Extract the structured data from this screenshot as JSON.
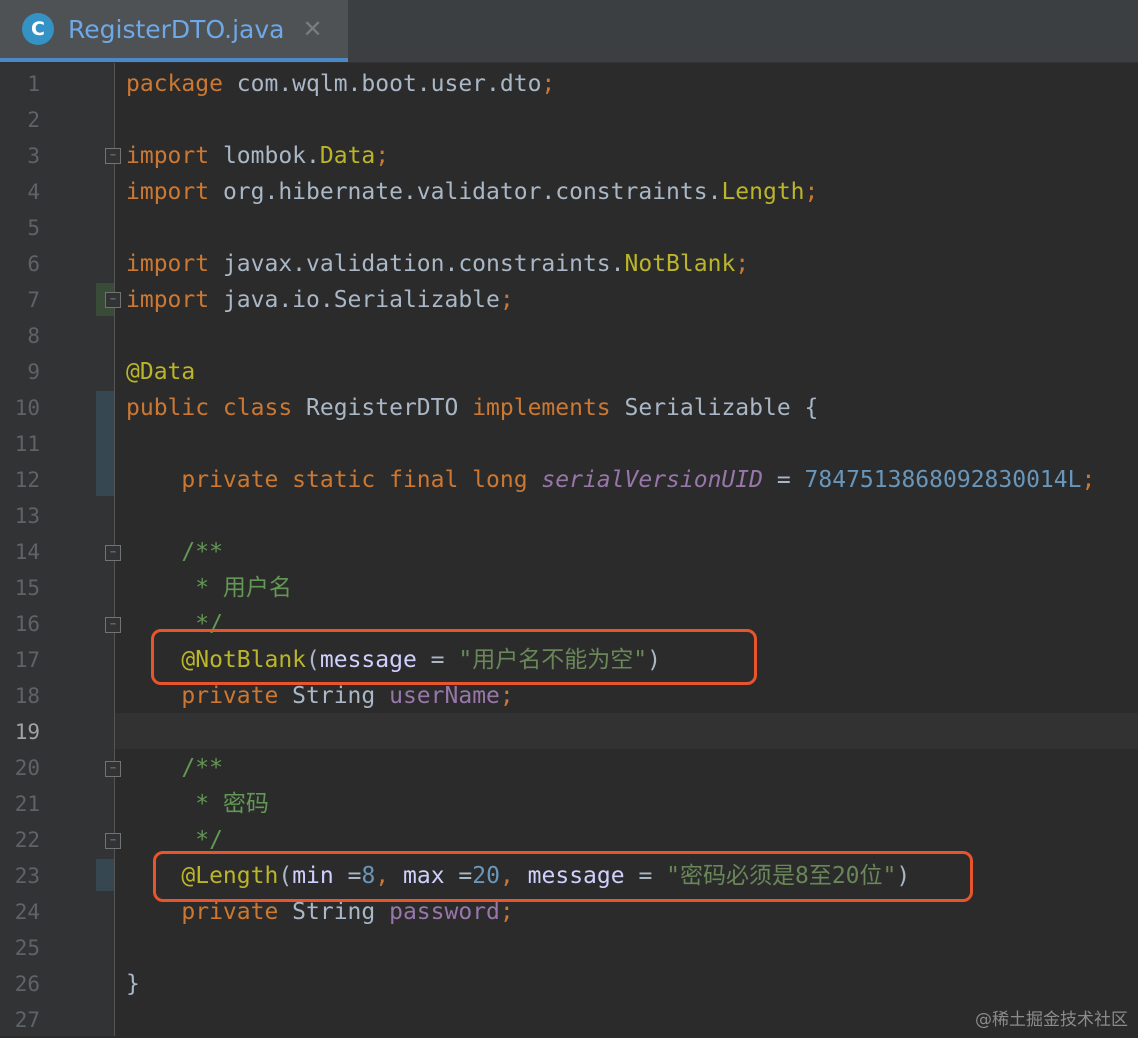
{
  "tab": {
    "icon_letter": "C",
    "title": "RegisterDTO.java",
    "close_glyph": "✕"
  },
  "lines": [
    {
      "n": "1",
      "segs": [
        [
          "kw",
          "package "
        ],
        [
          "p",
          "com.wqlm.boot.user.dto"
        ],
        [
          "kw",
          ";"
        ]
      ]
    },
    {
      "n": "2",
      "segs": []
    },
    {
      "n": "3",
      "segs": [
        [
          "kw",
          "import "
        ],
        [
          "p",
          "lombok."
        ],
        [
          "ann",
          "Data"
        ],
        [
          "kw",
          ";"
        ]
      ]
    },
    {
      "n": "4",
      "segs": [
        [
          "kw",
          "import "
        ],
        [
          "p",
          "org.hibernate.validator.constraints."
        ],
        [
          "ann",
          "Length"
        ],
        [
          "kw",
          ";"
        ]
      ]
    },
    {
      "n": "5",
      "segs": []
    },
    {
      "n": "6",
      "segs": [
        [
          "kw",
          "import "
        ],
        [
          "p",
          "javax.validation.constraints."
        ],
        [
          "ann",
          "NotBlank"
        ],
        [
          "kw",
          ";"
        ]
      ]
    },
    {
      "n": "7",
      "segs": [
        [
          "kw",
          "import "
        ],
        [
          "p",
          "java.io.Serializable"
        ],
        [
          "kw",
          ";"
        ]
      ]
    },
    {
      "n": "8",
      "segs": []
    },
    {
      "n": "9",
      "segs": [
        [
          "ann",
          "@Data"
        ]
      ]
    },
    {
      "n": "10",
      "segs": [
        [
          "kw",
          "public class "
        ],
        [
          "p",
          "RegisterDTO "
        ],
        [
          "kw",
          "implements "
        ],
        [
          "p",
          "Serializable {"
        ]
      ]
    },
    {
      "n": "11",
      "segs": []
    },
    {
      "n": "12",
      "segs": [
        [
          "p",
          "    "
        ],
        [
          "kw",
          "private static final long "
        ],
        [
          "sf",
          "serialVersionUID"
        ],
        [
          "p",
          " = "
        ],
        [
          "num",
          "7847513868092830014L"
        ],
        [
          "kw",
          ";"
        ]
      ]
    },
    {
      "n": "13",
      "segs": []
    },
    {
      "n": "14",
      "segs": [
        [
          "p",
          "    "
        ],
        [
          "cmt",
          "/**"
        ]
      ]
    },
    {
      "n": "15",
      "segs": [
        [
          "p",
          "    "
        ],
        [
          "cmt",
          " * 用户名"
        ]
      ]
    },
    {
      "n": "16",
      "segs": [
        [
          "p",
          "    "
        ],
        [
          "cmt",
          " */"
        ]
      ]
    },
    {
      "n": "17",
      "segs": [
        [
          "p",
          "    "
        ],
        [
          "ann",
          "@NotBlank"
        ],
        [
          "p",
          "("
        ],
        [
          "param",
          "message"
        ],
        [
          "p",
          " = "
        ],
        [
          "str",
          "\"用户名不能为空\""
        ],
        [
          "p",
          ")"
        ]
      ]
    },
    {
      "n": "18",
      "segs": [
        [
          "p",
          "    "
        ],
        [
          "kw",
          "private "
        ],
        [
          "p",
          "String "
        ],
        [
          "field",
          "userName"
        ],
        [
          "kw",
          ";"
        ]
      ]
    },
    {
      "n": "19",
      "segs": []
    },
    {
      "n": "20",
      "segs": [
        [
          "p",
          "    "
        ],
        [
          "cmt",
          "/**"
        ]
      ]
    },
    {
      "n": "21",
      "segs": [
        [
          "p",
          "    "
        ],
        [
          "cmt",
          " * 密码"
        ]
      ]
    },
    {
      "n": "22",
      "segs": [
        [
          "p",
          "    "
        ],
        [
          "cmt",
          " */"
        ]
      ]
    },
    {
      "n": "23",
      "segs": [
        [
          "p",
          "    "
        ],
        [
          "ann",
          "@Length"
        ],
        [
          "p",
          "("
        ],
        [
          "param",
          "min "
        ],
        [
          "p",
          "="
        ],
        [
          "num",
          "8"
        ],
        [
          "kw",
          ", "
        ],
        [
          "param",
          "max "
        ],
        [
          "p",
          "="
        ],
        [
          "num",
          "20"
        ],
        [
          "kw",
          ", "
        ],
        [
          "param",
          "message"
        ],
        [
          "p",
          " = "
        ],
        [
          "str",
          "\"密码必须是8至20位\""
        ],
        [
          "p",
          ")"
        ]
      ]
    },
    {
      "n": "24",
      "segs": [
        [
          "p",
          "    "
        ],
        [
          "kw",
          "private "
        ],
        [
          "p",
          "String "
        ],
        [
          "field",
          "password"
        ],
        [
          "kw",
          ";"
        ]
      ]
    },
    {
      "n": "25",
      "segs": []
    },
    {
      "n": "26",
      "segs": [
        [
          "p",
          "}"
        ]
      ]
    },
    {
      "n": "27",
      "segs": []
    }
  ],
  "current_line": "19",
  "watermark": "@稀土掘金技术社区",
  "colors": {
    "keyword": "#cc7832",
    "annotation": "#bbb529",
    "string": "#6a8759",
    "number": "#6897bb",
    "comment": "#629755",
    "field": "#9876aa",
    "highlight_box": "#e8552c"
  }
}
